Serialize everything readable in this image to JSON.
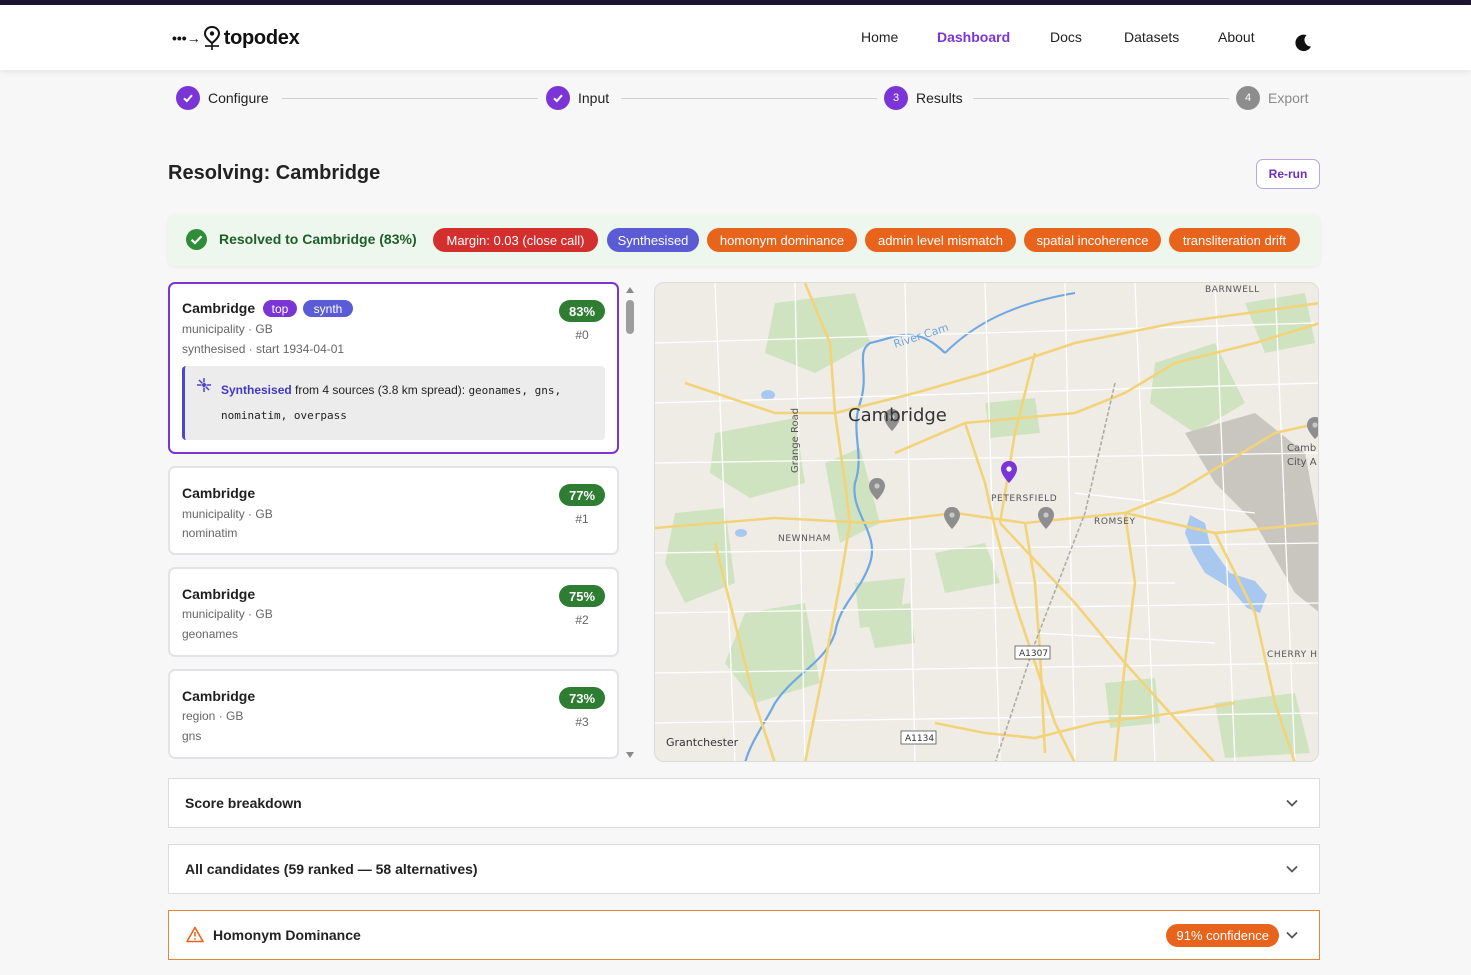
{
  "header": {
    "brand": "topodex",
    "brand_prefix": "•••→",
    "nav": [
      {
        "label": "Home",
        "active": false
      },
      {
        "label": "Dashboard",
        "active": true
      },
      {
        "label": "Docs",
        "active": false
      },
      {
        "label": "Datasets",
        "active": false
      },
      {
        "label": "About",
        "active": false
      }
    ],
    "theme_icon": "moon-icon"
  },
  "stepper": {
    "steps": [
      {
        "label": "Configure",
        "state": "done"
      },
      {
        "label": "Input",
        "state": "done"
      },
      {
        "label": "Results",
        "state": "current",
        "number": "3"
      },
      {
        "label": "Export",
        "state": "pending",
        "number": "4"
      }
    ]
  },
  "page": {
    "title": "Resolving: Cambridge",
    "rerun_label": "Re-run"
  },
  "resolution": {
    "summary": "Resolved to Cambridge (83%)",
    "chips": [
      {
        "label": "Margin: 0.03 (close call)",
        "color": "#d32f2f"
      },
      {
        "label": "Synthesised",
        "color": "#5b5bd6"
      },
      {
        "label": "homonym dominance",
        "color": "#e8641c"
      },
      {
        "label": "admin level mismatch",
        "color": "#e8641c"
      },
      {
        "label": "spatial incoherence",
        "color": "#e8641c"
      },
      {
        "label": "transliteration drift",
        "color": "#e8641c"
      }
    ]
  },
  "candidates": [
    {
      "name": "Cambridge",
      "tags": [
        {
          "label": "top",
          "color": "#7b35d6"
        },
        {
          "label": "synth",
          "color": "#5b5bd6"
        }
      ],
      "meta": "municipality · GB",
      "source": "synthesised · start 1934-04-01",
      "score": "83%",
      "rank": "#0",
      "selected": true,
      "synthesis": {
        "lead": "Synthesised",
        "text": " from 4 sources (3.8 km spread): ",
        "sources_a": "geonames, gns,",
        "sources_b": "nominatim, overpass"
      }
    },
    {
      "name": "Cambridge",
      "meta": "municipality · GB",
      "source": "nominatim",
      "score": "77%",
      "rank": "#1"
    },
    {
      "name": "Cambridge",
      "meta": "municipality · GB",
      "source": "geonames",
      "score": "75%",
      "rank": "#2"
    },
    {
      "name": "Cambridge",
      "meta": "region · GB",
      "source": "gns",
      "score": "73%",
      "rank": "#3"
    }
  ],
  "map": {
    "labels": {
      "city": "Cambridge",
      "barnwell": "BARNWELL",
      "petersfield": "PETERSFIELD",
      "romsey": "ROMSEY",
      "newnham": "NEWNHAM",
      "grantchester": "Grantchester",
      "cherry": "CHERRY H",
      "river": "River Cam",
      "grange": "Grange Road",
      "camb_city_a": "Camb",
      "camb_city_b": "City A",
      "road_a1307": "A1307",
      "road_a1134": "A1134"
    },
    "marker_selected_color": "#7b35d6",
    "marker_color": "#8e8e8e"
  },
  "sections": {
    "score_breakdown": "Score breakdown",
    "all_candidates": "All candidates (59 ranked — 58 alternatives)",
    "warning": {
      "title": "Homonym Dominance",
      "confidence": "91% confidence"
    }
  }
}
